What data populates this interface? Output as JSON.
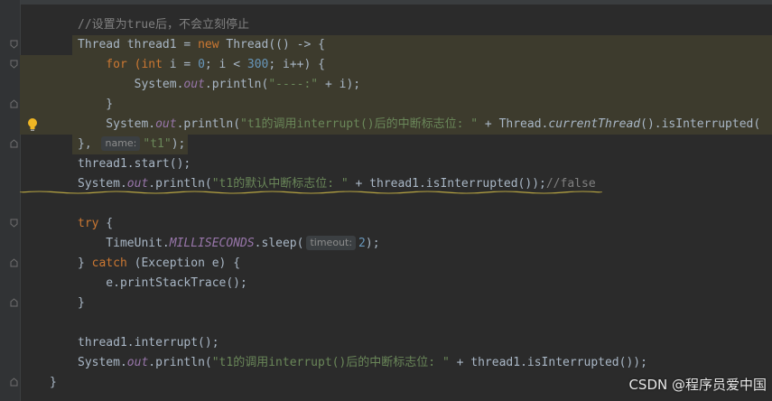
{
  "editor": {
    "lines": [
      [
        {
          "t": "//设置为true后，不会立刻停止",
          "c": "cmt"
        }
      ],
      [
        {
          "t": "Thread thread1 = ",
          "c": ""
        },
        {
          "t": "new",
          "c": "kw"
        },
        {
          "t": " Thread(() -> {",
          "c": ""
        }
      ],
      [
        {
          "t": "    for (",
          "c": "kw"
        },
        {
          "t": "int ",
          "c": "kw"
        },
        {
          "t": "i = ",
          "c": ""
        },
        {
          "t": "0",
          "c": "num"
        },
        {
          "t": "; i < ",
          "c": ""
        },
        {
          "t": "300",
          "c": "num"
        },
        {
          "t": "; i++) {",
          "c": ""
        }
      ],
      [
        {
          "t": "        System.",
          "c": ""
        },
        {
          "t": "out",
          "c": "it"
        },
        {
          "t": ".println(",
          "c": ""
        },
        {
          "t": "\"----:\"",
          "c": "str"
        },
        {
          "t": " + i);",
          "c": ""
        }
      ],
      [
        {
          "t": "    }",
          "c": ""
        }
      ],
      [
        {
          "t": "    System.",
          "c": ""
        },
        {
          "t": "out",
          "c": "it"
        },
        {
          "t": ".println(",
          "c": ""
        },
        {
          "t": "\"t1的调用interrupt()后的中断标志位: \"",
          "c": "str"
        },
        {
          "t": " + Thread.",
          "c": ""
        },
        {
          "t": "currentThread",
          "c": "static-m"
        },
        {
          "t": "().isInterrupted(",
          "c": ""
        }
      ],
      [
        {
          "t": "}, ",
          "c": ""
        },
        {
          "t": "name:",
          "c": "hint"
        },
        {
          "t": "\"t1\"",
          "c": "str"
        },
        {
          "t": ");",
          "c": ""
        }
      ],
      [
        {
          "t": "thread1.start();",
          "c": ""
        }
      ],
      [
        {
          "t": "System.",
          "c": ""
        },
        {
          "t": "out",
          "c": "it"
        },
        {
          "t": ".println(",
          "c": ""
        },
        {
          "t": "\"t1的默认中断标志位: \"",
          "c": "str"
        },
        {
          "t": " + thread1.isInterrupted());",
          "c": ""
        },
        {
          "t": "//false",
          "c": "cmt"
        }
      ],
      [
        {
          "t": "",
          "c": ""
        }
      ],
      [
        {
          "t": "try",
          "c": "kw"
        },
        {
          "t": " {",
          "c": ""
        }
      ],
      [
        {
          "t": "    TimeUnit.",
          "c": ""
        },
        {
          "t": "MILLISECONDS",
          "c": "it"
        },
        {
          "t": ".sleep(",
          "c": ""
        },
        {
          "t": "timeout:",
          "c": "hint"
        },
        {
          "t": "2",
          "c": "num"
        },
        {
          "t": ");",
          "c": ""
        }
      ],
      [
        {
          "t": "} ",
          "c": ""
        },
        {
          "t": "catch",
          "c": "kw"
        },
        {
          "t": " (Exception e) {",
          "c": ""
        }
      ],
      [
        {
          "t": "    e.printStackTrace();",
          "c": ""
        }
      ],
      [
        {
          "t": "}",
          "c": ""
        }
      ],
      [
        {
          "t": "",
          "c": ""
        }
      ],
      [
        {
          "t": "thread1.interrupt();",
          "c": ""
        }
      ],
      [
        {
          "t": "System.",
          "c": ""
        },
        {
          "t": "out",
          "c": "it"
        },
        {
          "t": ".println(",
          "c": ""
        },
        {
          "t": "\"t1的调用interrupt()后的中断标志位: \"",
          "c": "str"
        },
        {
          "t": " + thread1.isInterrupted());",
          "c": ""
        }
      ]
    ],
    "closing_brace": "}"
  },
  "colors": {
    "background": "#2b2b2b",
    "keyword": "#cc7832",
    "string": "#6a8759",
    "number": "#6897bb",
    "comment": "#808080",
    "field": "#9876aa",
    "text": "#a9b7c6"
  },
  "icons": {
    "fold": "fold-marker-icon",
    "intention": "lightbulb-icon"
  },
  "watermark": "CSDN @程序员爱中国"
}
